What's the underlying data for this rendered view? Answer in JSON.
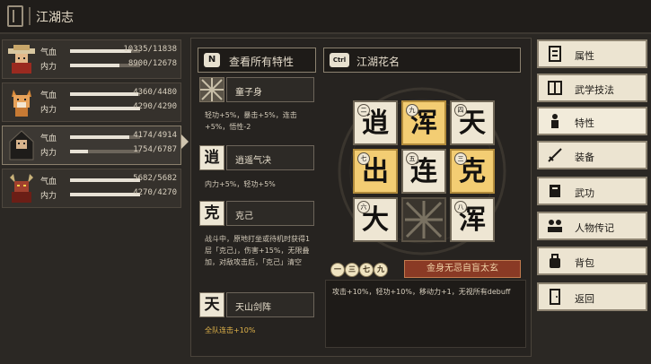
{
  "title": "江湖志",
  "party": [
    {
      "hp_label": "气血",
      "hp": "10335/11838",
      "hp_frac": 0.87,
      "mp_label": "内力",
      "mp": "8900/12678",
      "mp_frac": 0.7
    },
    {
      "hp_label": "气血",
      "hp": "4360/4480",
      "hp_frac": 0.97,
      "mp_label": "内力",
      "mp": "4290/4290",
      "mp_frac": 1.0
    },
    {
      "hp_label": "气血",
      "hp": "4174/4914",
      "hp_frac": 0.85,
      "mp_label": "内力",
      "mp": "1754/6787",
      "mp_frac": 0.26
    },
    {
      "hp_label": "气血",
      "hp": "5682/5682",
      "hp_frac": 1.0,
      "mp_label": "内力",
      "mp": "4270/4270",
      "mp_frac": 1.0
    }
  ],
  "buttons": {
    "view_traits_key": "N",
    "view_traits": "查看所有特性",
    "nickname_key": "Ctrl",
    "nickname": "江湖花名"
  },
  "traits": [
    {
      "icon": "",
      "name": "童子身",
      "desc": "轻功+5%，暴击+5%，连击+5%，悟性-2"
    },
    {
      "icon": "逍",
      "name": "逍遥气决",
      "desc": "内力+5%，轻功+5%"
    },
    {
      "icon": "克",
      "name": "克己",
      "desc": "战斗中，原地打坐或待机时获得1层「克己」，伤害+15%，无限叠加，对敌攻击后，「克己」清空"
    },
    {
      "icon": "天",
      "name": "天山剑阵",
      "desc": "全队连击+10%"
    }
  ],
  "grid": [
    {
      "char": "逍",
      "num": "二",
      "style": "light"
    },
    {
      "char": "浑",
      "num": "九",
      "style": "gold"
    },
    {
      "char": "天",
      "num": "四",
      "style": "light"
    },
    {
      "char": "出",
      "num": "七",
      "style": "gold"
    },
    {
      "char": "连",
      "num": "五",
      "style": "light"
    },
    {
      "char": "克",
      "num": "三",
      "style": "gold"
    },
    {
      "char": "大",
      "num": "六",
      "style": "light"
    },
    {
      "char": "",
      "num": "",
      "style": "dark"
    },
    {
      "char": "浑",
      "num": "八",
      "style": "light"
    }
  ],
  "combo": {
    "circles": [
      "一",
      "三",
      "七",
      "九"
    ],
    "name": "金身无忌自盲太玄",
    "desc": "攻击+10%，轻功+10%，移动力+1，无视所有debuff"
  },
  "menu": [
    {
      "label": "属性",
      "icon": "scroll-icon"
    },
    {
      "label": "武学技法",
      "icon": "book-icon"
    },
    {
      "label": "特性",
      "icon": "figure-icon"
    },
    {
      "label": "装备",
      "icon": "sword-icon"
    },
    {
      "label": "武功",
      "icon": "manual-icon"
    },
    {
      "label": "人物传记",
      "icon": "group-icon"
    },
    {
      "label": "背包",
      "icon": "bag-icon"
    },
    {
      "label": "返回",
      "icon": "door-icon"
    }
  ],
  "colors": {
    "gold_tile": "#f3cd73",
    "accent_red": "#8a3a25",
    "trait_gold": "#e0b34a"
  }
}
